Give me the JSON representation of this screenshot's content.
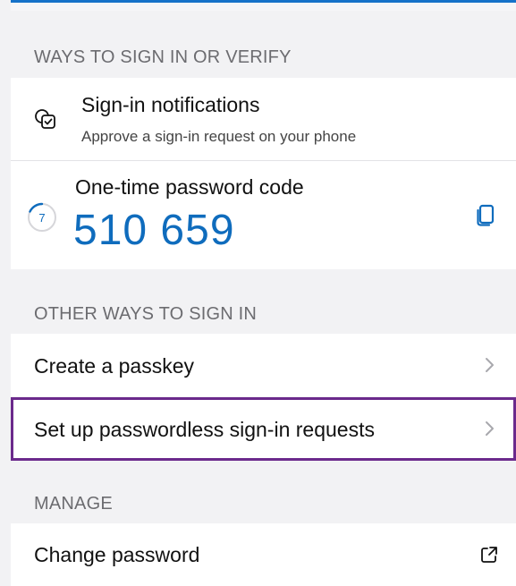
{
  "sections": {
    "ways_header": "WAYS TO SIGN IN OR VERIFY",
    "other_header": "OTHER WAYS TO SIGN IN",
    "manage_header": "MANAGE"
  },
  "sign_in_notifications": {
    "title": "Sign-in notifications",
    "subtitle": "Approve a sign-in request on your phone",
    "icon": "notification-check-icon"
  },
  "otp": {
    "title": "One-time password code",
    "code": "510 659",
    "timer": "7",
    "copy_icon": "copy-icon"
  },
  "other_ways": {
    "create_passkey": "Create a passkey",
    "passwordless": "Set up passwordless sign-in requests"
  },
  "manage": {
    "change_password": "Change password",
    "external_icon": "external-link-icon"
  },
  "colors": {
    "accent": "#0f6cbd",
    "highlight": "#6b2a8c",
    "background": "#f2f2f4"
  }
}
